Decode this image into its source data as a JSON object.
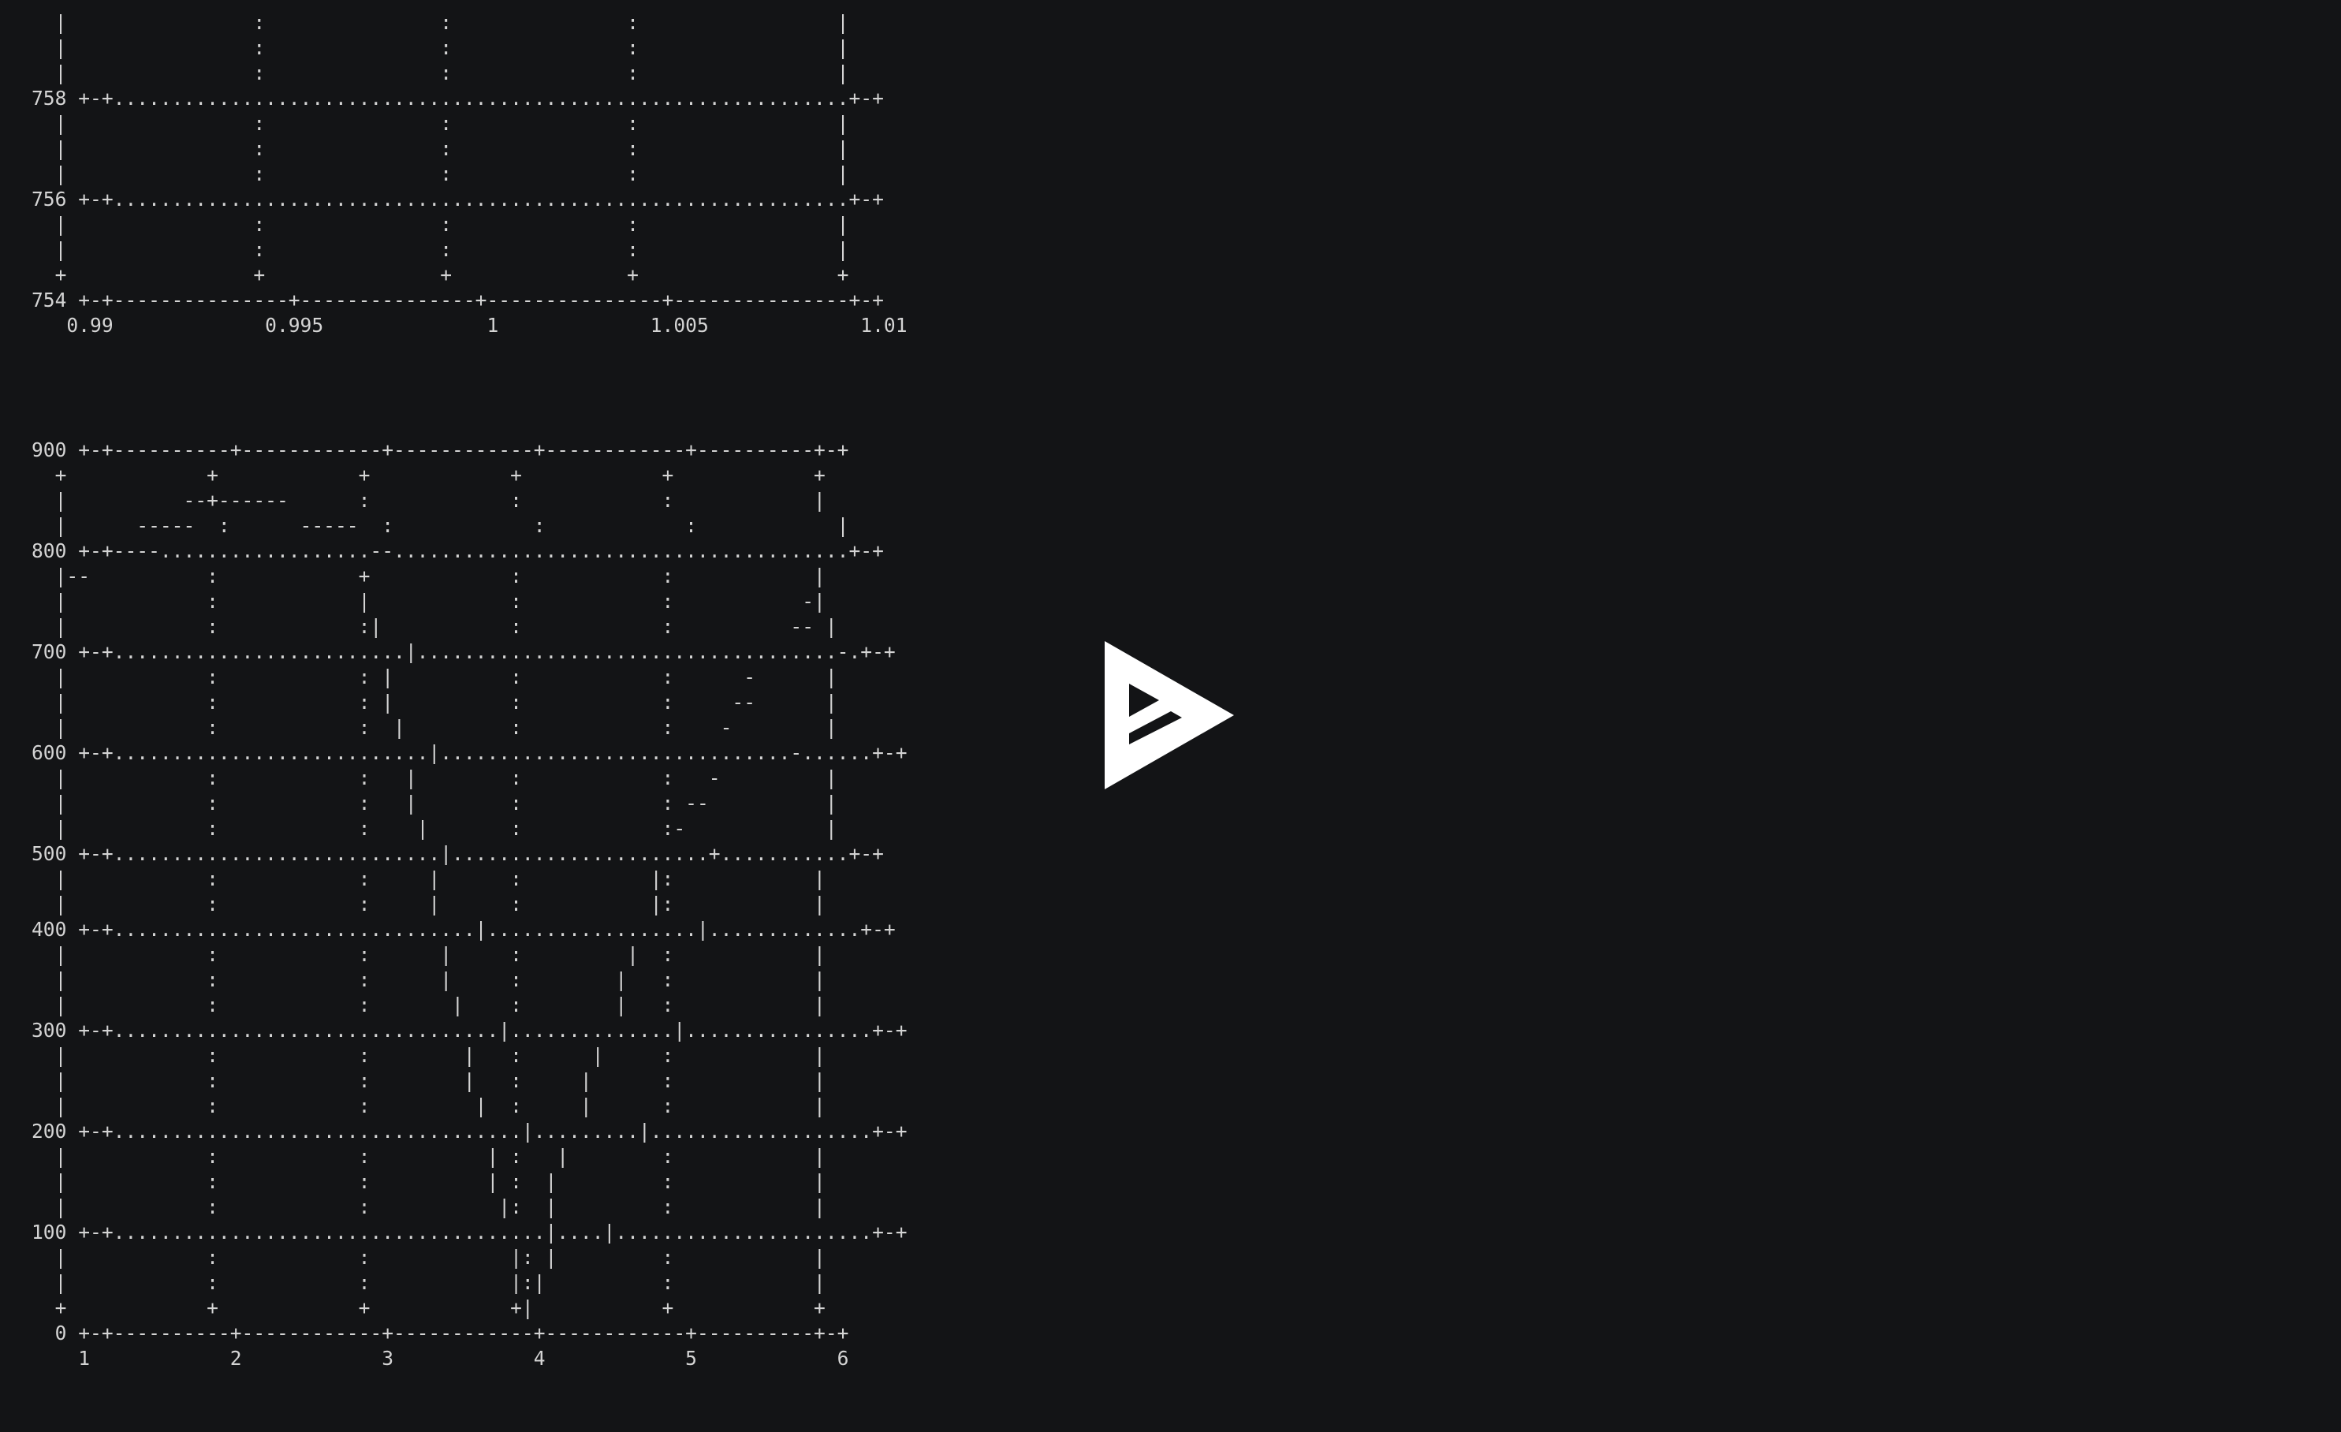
{
  "logo": {
    "icon": "asciinema-logo-icon",
    "color": "#ffffff"
  },
  "chart_data": [
    {
      "type": "line",
      "title": "",
      "xlabel": "",
      "ylabel": "",
      "x_ticks": [
        "0.99",
        "0.995",
        "1",
        "1.005",
        "1.01"
      ],
      "y_ticks": [
        "754",
        "756",
        "758"
      ],
      "xlim": [
        0.99,
        1.01
      ],
      "ylim": [
        754,
        758
      ],
      "grid": true,
      "text": [
        "  |                :               :               :                 |",
        "  |                :               :               :                 |",
        "  |                :               :               :                 |",
        "758 +-+...............................................................+-+",
        "  |                :               :               :                 |",
        "  |                :               :               :                 |",
        "  |                :               :               :                 |",
        "756 +-+...............................................................+-+",
        "  |                :               :               :                 |",
        "  |                :               :               :                 |",
        "  +                +               +               +                 +",
        "754 +-+---------------+---------------+---------------+---------------+-+",
        "   0.99             0.995              1             1.005             1.01"
      ]
    },
    {
      "type": "line",
      "title": "",
      "xlabel": "",
      "ylabel": "",
      "x": [
        1,
        1.8,
        2,
        2.4,
        3,
        3.5,
        4,
        4.5,
        5,
        5.5,
        6
      ],
      "y": [
        790,
        820,
        840,
        820,
        800,
        500,
        0,
        300,
        520,
        650,
        760
      ],
      "x_ticks": [
        "1",
        "2",
        "3",
        "4",
        "5",
        "6"
      ],
      "y_ticks": [
        "0",
        "100",
        "200",
        "300",
        "400",
        "500",
        "600",
        "700",
        "800",
        "900"
      ],
      "xlim": [
        1,
        6
      ],
      "ylim": [
        0,
        900
      ],
      "grid": true,
      "text": [
        "900 +-+----------+------------+------------+------------+----------+-+",
        "  +            +            +            +            +            +",
        "  |          --+------      :            :            :            |",
        "  |      -----  :      -----  :            :            :            |",
        "800 +-+----..................--.......................................+-+",
        "  |--          :            +            :            :            |",
        "  |            :            |            :            :           -|",
        "  |            :            :|           :            :          -- |",
        "700 +-+.........................|....................................-.+-+",
        "  |            :            : |          :            :      -      |",
        "  |            :            : |          :            :     --      |",
        "  |            :            :  |         :            :    -        |",
        "600 +-+...........................|..............................-......+-+",
        "  |            :            :   |        :            :   -         |",
        "  |            :            :   |        :            : --          |",
        "  |            :            :    |       :            :-            |",
        "500 +-+............................|......................+...........+-+",
        "  |            :            :     |      :           |:            |",
        "  |            :            :     |      :           |:            |",
        "400 +-+...............................|..................|.............+-+",
        "  |            :            :      |     :         |  :            |",
        "  |            :            :      |     :        |   :            |",
        "  |            :            :       |    :        |   :            |",
        "300 +-+.................................|..............|................+-+",
        "  |            :            :        |   :      |     :            |",
        "  |            :            :        |   :     |      :            |",
        "  |            :            :         |  :     |      :            |",
        "200 +-+...................................|.........|...................+-+",
        "  |            :            :          | :   |        :            |",
        "  |            :            :          | :  |         :            |",
        "  |            :            :           |:  |         :            |",
        "100 +-+.....................................|....|......................+-+",
        "  |            :            :            |: |         :            |",
        "  |            :            :            |:|          :            |",
        "  +            +            +            +|           +            +",
        "  0 +-+----------+------------+------------+------------+----------+-+",
        "    1            2            3            4            5            6"
      ]
    }
  ]
}
